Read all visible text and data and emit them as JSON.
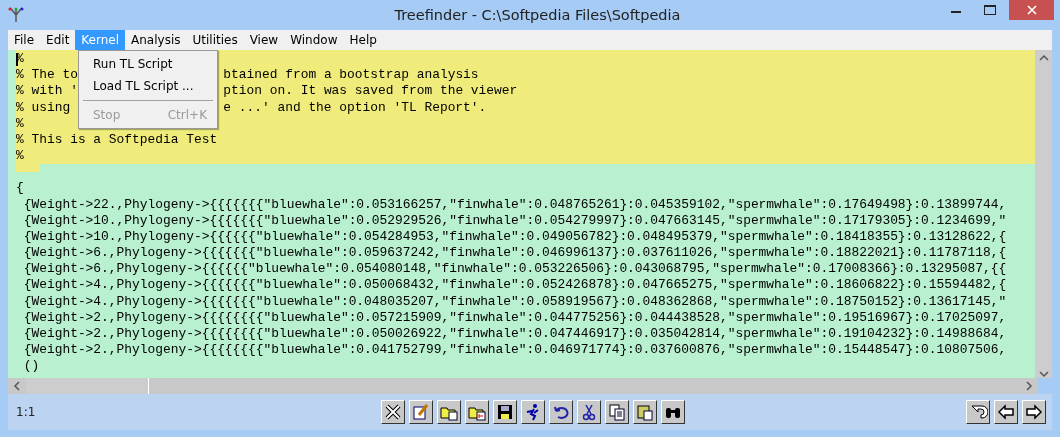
{
  "window": {
    "title": "Treefinder - C:\\Softpedia Files\\Softpedia"
  },
  "menu": [
    {
      "label": "File",
      "selected": false
    },
    {
      "label": "Edit",
      "selected": false
    },
    {
      "label": "Kernel",
      "selected": true
    },
    {
      "label": "Analysis",
      "selected": false
    },
    {
      "label": "Utilities",
      "selected": false
    },
    {
      "label": "View",
      "selected": false
    },
    {
      "label": "Window",
      "selected": false
    },
    {
      "label": "Help",
      "selected": false
    }
  ],
  "open_menu": {
    "items": [
      {
        "kind": "item",
        "label": "Run TL Script",
        "disabled": false
      },
      {
        "kind": "item",
        "label": "Load TL Script ...",
        "disabled": false
      },
      {
        "kind": "separator"
      },
      {
        "kind": "item",
        "label": "Stop",
        "shortcut": "Ctrl+K",
        "disabled": true
      }
    ]
  },
  "editor": {
    "comment_lines": [
      {
        "left": "%"
      },
      {
        "left": "% The to",
        "right": "btained from a bootstrap analysis"
      },
      {
        "left": "% with '",
        "right": "ption on. It was saved from the viewer"
      },
      {
        "left": "% using",
        "right": "e ...' and the option 'TL Report'."
      },
      {
        "left": "%"
      },
      {
        "left": "% This is a Softpedia Test"
      },
      {
        "left": "%"
      }
    ],
    "open": "{",
    "rows": [
      "{Weight->22.,Phylogeny->{{{{{{{\"bluewhale\":0.053166257,\"finwhale\":0.048765261}:0.045359102,\"spermwhale\":0.17649498}:0.13899744,",
      "{Weight->10.,Phylogeny->{{{{{{{\"bluewhale\":0.052929526,\"finwhale\":0.054279997}:0.047663145,\"spermwhale\":0.17179305}:0.1234699,\"",
      "{Weight->10.,Phylogeny->{{{{{{\"bluewhale\":0.054284953,\"finwhale\":0.049056782}:0.048495379,\"spermwhale\":0.18418355}:0.13128622,{",
      "{Weight->6.,Phylogeny->{{{{{{{\"bluewhale\":0.059637242,\"finwhale\":0.046996137}:0.037611026,\"spermwhale\":0.18822021}:0.11787118,{",
      "{Weight->6.,Phylogeny->{{{{{{\"bluewhale\":0.054080148,\"finwhale\":0.053226506}:0.043068795,\"spermwhale\":0.17008366}:0.13295087,{{",
      "{Weight->4.,Phylogeny->{{{{{{{\"bluewhale\":0.050068432,\"finwhale\":0.052426878}:0.047665275,\"spermwhale\":0.18606822}:0.15594482,{",
      "{Weight->4.,Phylogeny->{{{{{{{\"bluewhale\":0.048035207,\"finwhale\":0.058919567}:0.048362868,\"spermwhale\":0.18750152}:0.13617145,\"",
      "{Weight->2.,Phylogeny->{{{{{{{{\"bluewhale\":0.057215909,\"finwhale\":0.044775256}:0.044438528,\"spermwhale\":0.19516967}:0.17025097,",
      "{Weight->2.,Phylogeny->{{{{{{{{\"bluewhale\":0.050026922,\"finwhale\":0.047446917}:0.035042814,\"spermwhale\":0.19104232}:0.14988684,",
      "{Weight->2.,Phylogeny->{{{{{{{{\"bluewhale\":0.041752799,\"finwhale\":0.046971774}:0.037600876,\"spermwhale\":0.15448547}:0.10807506,"
    ],
    "close": "()"
  },
  "status_bar": {
    "position": "1:1"
  }
}
